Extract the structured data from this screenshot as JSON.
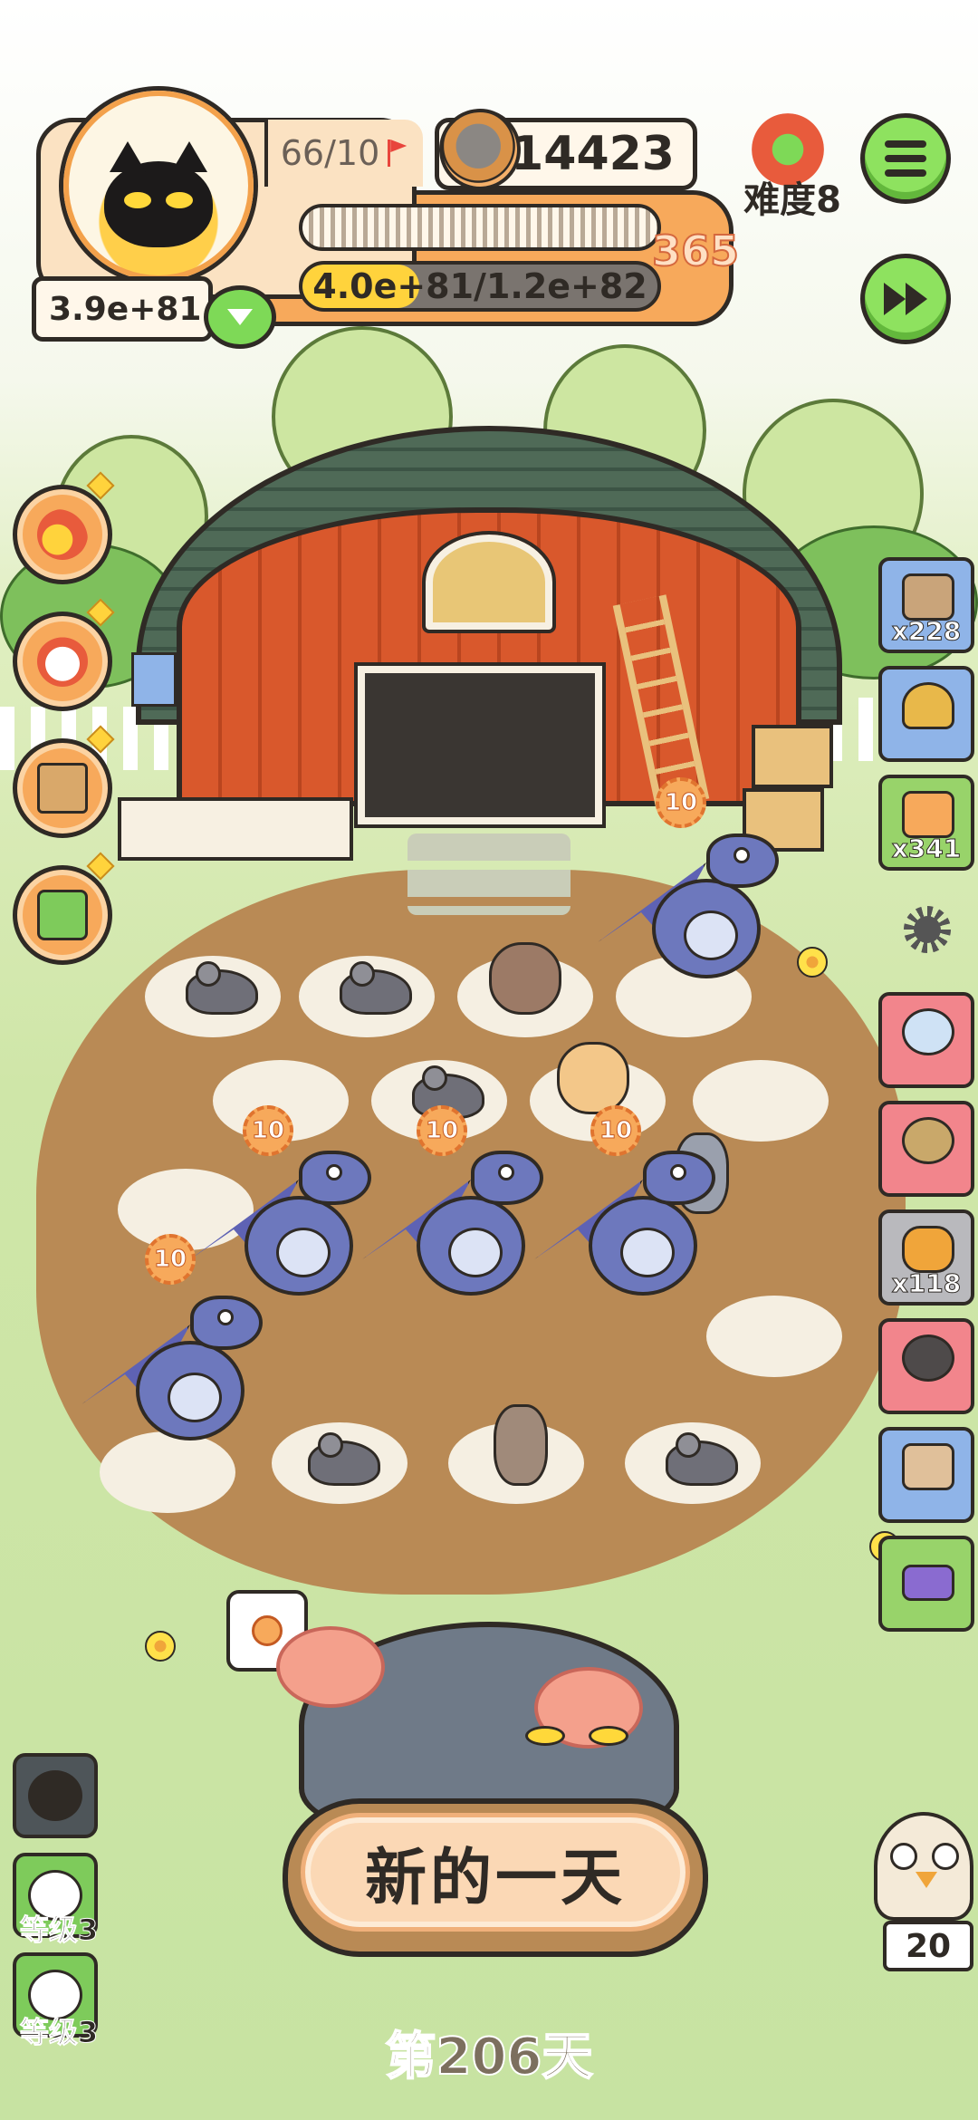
{
  "hud": {
    "capacity": "66/10",
    "coins": "14423",
    "counter": "365",
    "progress_text": "4.0e+81/1.2e+82",
    "progress_fraction": 0.33,
    "stat_value": "3.9e+81",
    "difficulty_label": "难度8"
  },
  "left_menu": {
    "items": [
      {
        "icon": "egg-bowl-icon"
      },
      {
        "icon": "chicken-icon"
      },
      {
        "icon": "box-icon"
      },
      {
        "icon": "first-aid-kit-icon"
      }
    ]
  },
  "right_items": [
    {
      "icon": "sack-icon",
      "count": "x228",
      "color": "#8fb4e8"
    },
    {
      "icon": "trophy-icon",
      "count": "",
      "color": "#8fb4e8"
    },
    {
      "icon": "ticket-icon",
      "count": "x341",
      "color": "#98d36a"
    },
    {
      "icon": "cloud-creature-icon",
      "count": "",
      "color": "#f2858c"
    },
    {
      "icon": "snake-icon",
      "count": "",
      "color": "#f2858c"
    },
    {
      "icon": "worm-icon",
      "count": "x118",
      "color": "#b9b9bd"
    },
    {
      "icon": "love-creature-icon",
      "count": "",
      "color": "#f2858c"
    },
    {
      "icon": "arcade-machine-icon",
      "count": "",
      "color": "#8fb4e8"
    },
    {
      "icon": "credit-card-icon",
      "count": "",
      "color": "#98d36a"
    }
  ],
  "field": {
    "badges": [
      "10",
      "10",
      "10",
      "10",
      "10"
    ]
  },
  "bottom": {
    "new_day_label": "新的一天",
    "day_label": "第206天",
    "level_slots": [
      {
        "icon": "dark-creature-icon",
        "label": ""
      },
      {
        "icon": "frog-icon",
        "label": "等级3"
      },
      {
        "icon": "ghost-icon",
        "label": "等级3"
      }
    ],
    "owl_count": "20"
  },
  "colors": {
    "accent_orange": "#f7a95b",
    "button_green": "#8ee25f",
    "outline": "#2f2a25",
    "progress_yellow": "#ffd33c"
  }
}
